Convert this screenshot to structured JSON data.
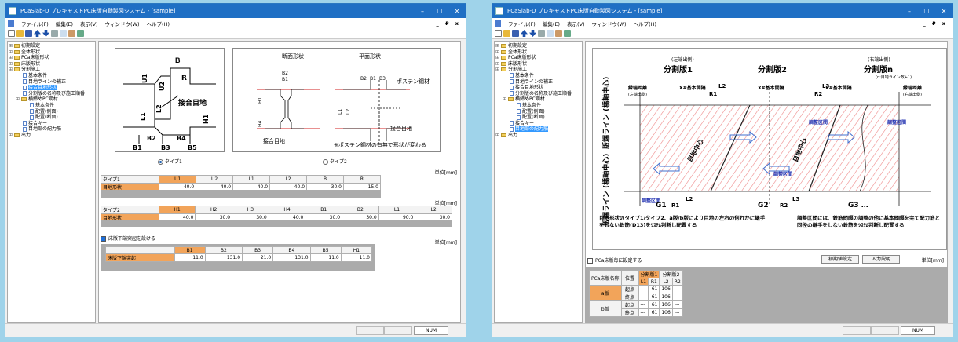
{
  "title": "PCaSlab-D プレキャストPC床版自動製図システム - [sample]",
  "menu": [
    "ファイル(F)",
    "編集(E)",
    "表示(V)",
    "ウィンドウ(W)",
    "ヘルプ(H)"
  ],
  "mdi_controls": "_ ₽ x",
  "status_num": "NUM",
  "tree_left": [
    {
      "label": "初期設定",
      "indent": 0,
      "kind": "folder"
    },
    {
      "label": "全体形状",
      "indent": 0,
      "kind": "folder"
    },
    {
      "label": "PCa床版形状",
      "indent": 0,
      "kind": "folder"
    },
    {
      "label": "床版形状",
      "indent": 0,
      "kind": "folder"
    },
    {
      "label": "分割施工",
      "indent": 0,
      "kind": "folder"
    },
    {
      "label": "基本条件",
      "indent": 1,
      "kind": "doc"
    },
    {
      "label": "目地ラインの補正",
      "indent": 1,
      "kind": "doc"
    },
    {
      "label": "接合目地形状",
      "indent": 1,
      "kind": "doc",
      "selected": true
    },
    {
      "label": "分割版の名称及び施工順番",
      "indent": 1,
      "kind": "doc"
    },
    {
      "label": "横締めPC鋼材",
      "indent": 1,
      "kind": "folder"
    },
    {
      "label": "基本条件",
      "indent": 2,
      "kind": "doc"
    },
    {
      "label": "配置(側面)",
      "indent": 2,
      "kind": "doc"
    },
    {
      "label": "配置(断面)",
      "indent": 2,
      "kind": "doc"
    },
    {
      "label": "接合キー",
      "indent": 1,
      "kind": "doc"
    },
    {
      "label": "目地部の配力筋",
      "indent": 1,
      "kind": "doc"
    },
    {
      "label": "出力",
      "indent": 0,
      "kind": "folder"
    }
  ],
  "tree_right": [
    {
      "label": "初期設定",
      "indent": 0,
      "kind": "folder"
    },
    {
      "label": "全体形状",
      "indent": 0,
      "kind": "folder"
    },
    {
      "label": "PCa床版形状",
      "indent": 0,
      "kind": "folder"
    },
    {
      "label": "床版形状",
      "indent": 0,
      "kind": "folder"
    },
    {
      "label": "分割施工",
      "indent": 0,
      "kind": "folder"
    },
    {
      "label": "基本条件",
      "indent": 1,
      "kind": "doc"
    },
    {
      "label": "目地ラインの補正",
      "indent": 1,
      "kind": "doc"
    },
    {
      "label": "接合目地形状",
      "indent": 1,
      "kind": "doc"
    },
    {
      "label": "分割版の名称及び施工順番",
      "indent": 1,
      "kind": "doc"
    },
    {
      "label": "横締めPC鋼材",
      "indent": 1,
      "kind": "folder"
    },
    {
      "label": "基本条件",
      "indent": 2,
      "kind": "doc"
    },
    {
      "label": "配置(側面)",
      "indent": 2,
      "kind": "doc"
    },
    {
      "label": "配置(断面)",
      "indent": 2,
      "kind": "doc"
    },
    {
      "label": "接合キー",
      "indent": 1,
      "kind": "doc"
    },
    {
      "label": "目地部の配力筋",
      "indent": 1,
      "kind": "doc",
      "selected": true
    },
    {
      "label": "出力",
      "indent": 0,
      "kind": "folder"
    }
  ],
  "left": {
    "diagram1": {
      "B": "B",
      "U1": "U1",
      "U2": "U2",
      "R": "R",
      "L1": "L1",
      "L2": "L2",
      "H1": "H1",
      "joint": "接合目地",
      "B1": "B1",
      "B2": "B2",
      "B3": "B3",
      "B4": "B4",
      "B5": "B5"
    },
    "diagram2": {
      "section_title": "断面形状",
      "plan_title": "平面形状",
      "pc_label": "ポステン鋼材",
      "joint1": "接合目地",
      "joint2": "接合目地",
      "note": "※ポステン鋼材の有無で形状が変わる",
      "b1": "B1",
      "b2": "B2",
      "b3": "B3",
      "b4": "B4",
      "h1": "H1",
      "h2": "H2",
      "h3": "H3",
      "h4": "H4",
      "l1": "L1",
      "l2": "L2"
    },
    "radio1": "タイプ1",
    "radio2": "タイプ2",
    "unit": "単位[mm]",
    "table1": {
      "corner": "タイプ1",
      "headers": [
        "U1",
        "U2",
        "L1",
        "L2",
        "B",
        "R"
      ],
      "row_label": "目地形状",
      "values": [
        "40.0",
        "40.0",
        "40.0",
        "40.0",
        "30.0",
        "15.0"
      ]
    },
    "table2": {
      "corner": "タイプ2",
      "headers": [
        "H1",
        "H2",
        "H3",
        "H4",
        "B1",
        "B2",
        "L1",
        "L2"
      ],
      "row_label": "目地形状",
      "values": [
        "40.0",
        "30.0",
        "30.0",
        "40.0",
        "30.0",
        "30.0",
        "90.0",
        "30.0"
      ]
    },
    "checkbox": "床版下端突起を設ける",
    "table3": {
      "headers": [
        "B1",
        "B2",
        "B3",
        "B4",
        "B5",
        "H1"
      ],
      "row_label": "床版下端突起",
      "values": [
        "11.0",
        "131.0",
        "21.0",
        "131.0",
        "11.0",
        "11.0"
      ]
    }
  },
  "right": {
    "top": {
      "left_note": "(左端出側)",
      "right_note": "(右端出側)",
      "sub_note": "(n:目地ライン数+1)",
      "p1": "分割版1",
      "p2": "分割版2",
      "pn": "分割版n"
    },
    "dims": {
      "edge_l": "縁端距離",
      "edge_l2": "(左端出側)",
      "base1": "X#基本間隔",
      "base2": "X#基本間隔",
      "base3": "X#基本間隔",
      "edge_r": "縁端距離",
      "edge_r2": "(右端出側)",
      "L2": "L2",
      "R1": "R1",
      "L3": "L3",
      "R2": "R2"
    },
    "side": {
      "top": "版端ライン (橋軸中心)",
      "bottom": "版端ライン (橋軸中心)"
    },
    "labels": {
      "adj1": "調整区間",
      "adj2": "調整区間",
      "adj3": "調整区間",
      "adj4": "調整区間",
      "joint_center1": "目地中心",
      "joint_center2": "目地中心",
      "G1": "G1",
      "G2": "G2",
      "G3": "G3 …",
      "R1b": "R1",
      "L2b": "L2",
      "R2b": "R2",
      "L3b": "L3"
    },
    "note_left": "目地形状のタイプ1/タイプ2、a版/b版により目地の左右の何れかに継手をしない鉄筋(D13)をｼｽﾃﾑ判断し配置する",
    "note_right": "調整区間には、鉄筋間隔の調整の他に基本間隔を完て配力筋と同径の継手をしない鉄筋をｼｽﾃﾑ判断し配置する",
    "checkbox": "PCa床版毎に設定する",
    "btn1": "初期値設定",
    "btn2": "入力説明",
    "unit": "単位[mm]",
    "table": {
      "h_name": "PCa床版名称",
      "h_pos": "位置",
      "panel1": "分割版1",
      "panel2": "分割版2",
      "sub": [
        "L1",
        "R1",
        "L2",
        "R2"
      ],
      "rows": [
        {
          "name": "a版",
          "pos": "起点",
          "vals": [
            "---",
            "61",
            "106",
            "---"
          ]
        },
        {
          "name": "",
          "pos": "終点",
          "vals": [
            "---",
            "61",
            "106",
            "---"
          ]
        },
        {
          "name": "b版",
          "pos": "起点",
          "vals": [
            "---",
            "61",
            "106",
            "---"
          ]
        },
        {
          "name": "",
          "pos": "終点",
          "vals": [
            "---",
            "61",
            "106",
            "---"
          ]
        }
      ]
    }
  }
}
